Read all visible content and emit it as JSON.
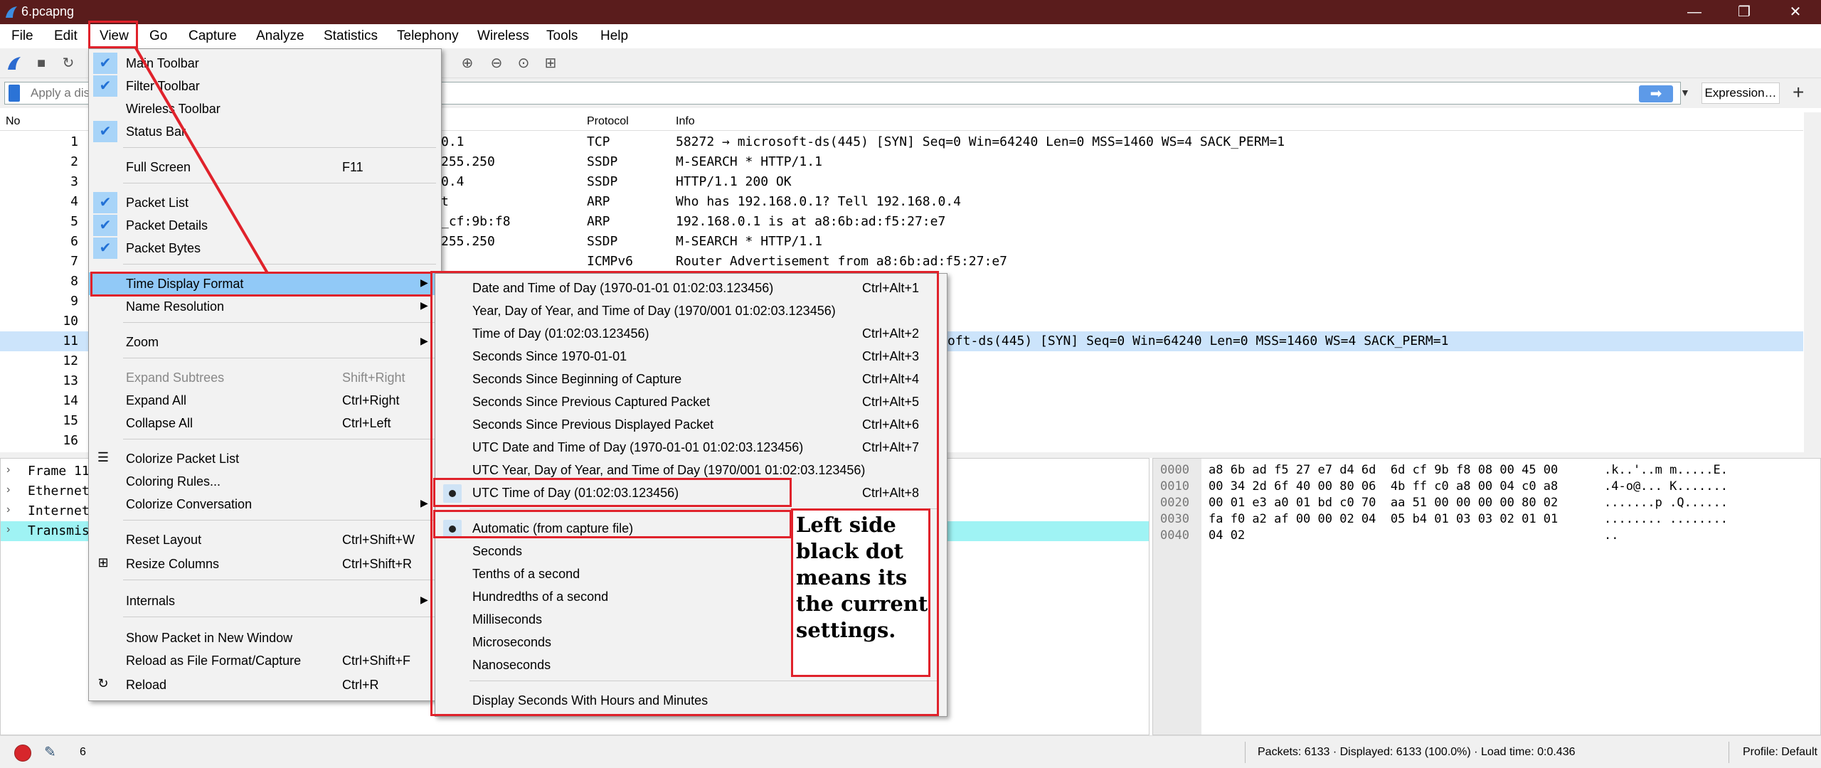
{
  "window": {
    "title": "6.pcapng",
    "minimize": "—",
    "maximize": "❐",
    "close": "✕"
  },
  "menubar": [
    "File",
    "Edit",
    "View",
    "Go",
    "Capture",
    "Analyze",
    "Statistics",
    "Telephony",
    "Wireless",
    "Tools",
    "Help"
  ],
  "filter": {
    "placeholder": "Apply a display filter … <Ctrl-/>",
    "visible_text": "Apply a dis",
    "expression_label": "Expression…"
  },
  "packet_list": {
    "headers": {
      "no": "No",
      "protocol": "Protocol",
      "info": "Info"
    },
    "rows": [
      {
        "no": "1",
        "partial": "0.1",
        "protocol": "TCP",
        "info": "58272 → microsoft-ds(445) [SYN] Seq=0 Win=64240 Len=0 MSS=1460 WS=4 SACK_PERM=1"
      },
      {
        "no": "2",
        "partial": "255.250",
        "protocol": "SSDP",
        "info": "M-SEARCH * HTTP/1.1"
      },
      {
        "no": "3",
        "partial": "0.4",
        "protocol": "SSDP",
        "info": "HTTP/1.1 200 OK"
      },
      {
        "no": "4",
        "partial": "t",
        "protocol": "ARP",
        "info": "Who has 192.168.0.1? Tell 192.168.0.4"
      },
      {
        "no": "5",
        "partial": "_cf:9b:f8",
        "protocol": "ARP",
        "info": "192.168.0.1 is at a8:6b:ad:f5:27:e7"
      },
      {
        "no": "6",
        "partial": "255.250",
        "protocol": "SSDP",
        "info": "M-SEARCH * HTTP/1.1"
      },
      {
        "no": "7",
        "partial": "",
        "protocol": "ICMPv6",
        "info": "Router Advertisement from a8:6b:ad:f5:27:e7"
      },
      {
        "no": "8",
        "partial": "",
        "protocol": "",
        "info": ""
      },
      {
        "no": "9",
        "partial": "",
        "protocol": "",
        "info": ""
      },
      {
        "no": "10",
        "partial": "",
        "protocol": "",
        "info": ""
      },
      {
        "no": "11",
        "partial": "",
        "protocol": "",
        "info": "oft-ds(445) [SYN] Seq=0 Win=64240 Len=0 MSS=1460 WS=4 SACK_PERM=1"
      },
      {
        "no": "12",
        "partial": "",
        "protocol": "",
        "info": ""
      },
      {
        "no": "13",
        "partial": "",
        "protocol": "",
        "info": ""
      },
      {
        "no": "14",
        "partial": "",
        "protocol": "",
        "info": ""
      },
      {
        "no": "15",
        "partial": "",
        "protocol": "",
        "info": ""
      },
      {
        "no": "16",
        "partial": "",
        "protocol": "",
        "info": ""
      }
    ]
  },
  "details": [
    "Frame 11",
    "Ethernet",
    "Internet",
    "Transmis"
  ],
  "bytes": {
    "offsets": [
      "0000",
      "0010",
      "0020",
      "0030",
      "0040"
    ],
    "hex": [
      "a8 6b ad f5 27 e7 d4 6d  6d cf 9b f8 08 00 45 00",
      "00 34 2d 6f 40 00 80 06  4b ff c0 a8 00 04 c0 a8",
      "00 01 e3 a0 01 bd c0 70  aa 51 00 00 00 00 80 02",
      "fa f0 a2 af 00 00 02 04  05 b4 01 03 03 02 01 01",
      "04 02"
    ],
    "ascii": [
      ".k..'..m m.....E.",
      ".4-o@... K.......",
      ".......p .Q......",
      "........ ........",
      ".."
    ]
  },
  "view_menu": {
    "main_toolbar": "Main Toolbar",
    "filter_toolbar": "Filter Toolbar",
    "wireless_toolbar": "Wireless Toolbar",
    "status_bar": "Status Bar",
    "full_screen": "Full Screen",
    "full_screen_sc": "F11",
    "packet_list": "Packet List",
    "packet_details": "Packet Details",
    "packet_bytes": "Packet Bytes",
    "time_display_format": "Time Display Format",
    "name_resolution": "Name Resolution",
    "zoom": "Zoom",
    "expand_subtrees": "Expand Subtrees",
    "expand_subtrees_sc": "Shift+Right",
    "expand_all": "Expand All",
    "expand_all_sc": "Ctrl+Right",
    "collapse_all": "Collapse All",
    "collapse_all_sc": "Ctrl+Left",
    "colorize_packet_list": "Colorize Packet List",
    "coloring_rules": "Coloring Rules...",
    "colorize_conversation": "Colorize Conversation",
    "reset_layout": "Reset Layout",
    "reset_layout_sc": "Ctrl+Shift+W",
    "resize_columns": "Resize Columns",
    "resize_columns_sc": "Ctrl+Shift+R",
    "internals": "Internals",
    "show_packet_new_window": "Show Packet in New Window",
    "reload_as_file_format": "Reload as File Format/Capture",
    "reload_as_file_format_sc": "Ctrl+Shift+F",
    "reload": "Reload",
    "reload_sc": "Ctrl+R"
  },
  "time_menu": {
    "date_time": "Date and Time of Day (1970-01-01 01:02:03.123456)",
    "date_time_sc": "Ctrl+Alt+1",
    "year_doy": "Year, Day of Year, and Time of Day (1970/001 01:02:03.123456)",
    "tod": "Time of Day (01:02:03.123456)",
    "tod_sc": "Ctrl+Alt+2",
    "since_epoch": "Seconds Since 1970-01-01",
    "since_epoch_sc": "Ctrl+Alt+3",
    "since_begin": "Seconds Since Beginning of Capture",
    "since_begin_sc": "Ctrl+Alt+4",
    "since_prev_capt": "Seconds Since Previous Captured Packet",
    "since_prev_capt_sc": "Ctrl+Alt+5",
    "since_prev_disp": "Seconds Since Previous Displayed Packet",
    "since_prev_disp_sc": "Ctrl+Alt+6",
    "utc_date_time": "UTC Date and Time of Day (1970-01-01 01:02:03.123456)",
    "utc_date_time_sc": "Ctrl+Alt+7",
    "utc_year_doy": "UTC Year, Day of Year, and Time of Day (1970/001 01:02:03.123456)",
    "utc_tod": "UTC Time of Day (01:02:03.123456)",
    "utc_tod_sc": "Ctrl+Alt+8",
    "automatic": "Automatic (from capture file)",
    "seconds": "Seconds",
    "tenths": "Tenths of a second",
    "hundredths": "Hundredths of a second",
    "milliseconds": "Milliseconds",
    "microseconds": "Microseconds",
    "nanoseconds": "Nanoseconds",
    "hours_minutes": "Display Seconds With Hours and Minutes"
  },
  "annotation": "Left side black dot means its the current settings.",
  "statusbar": {
    "count": "6",
    "packets": "Packets: 6133 · Displayed: 6133 (100.0%) · Load time: 0:0.436",
    "profile": "Profile: Default"
  },
  "colors": {
    "titlebar": "#5a1c1c",
    "highlight": "#91c9f7",
    "annotation_red": "#e0222b",
    "selected_row": "#cce4fb",
    "details_highlight": "#9ff3f4"
  }
}
